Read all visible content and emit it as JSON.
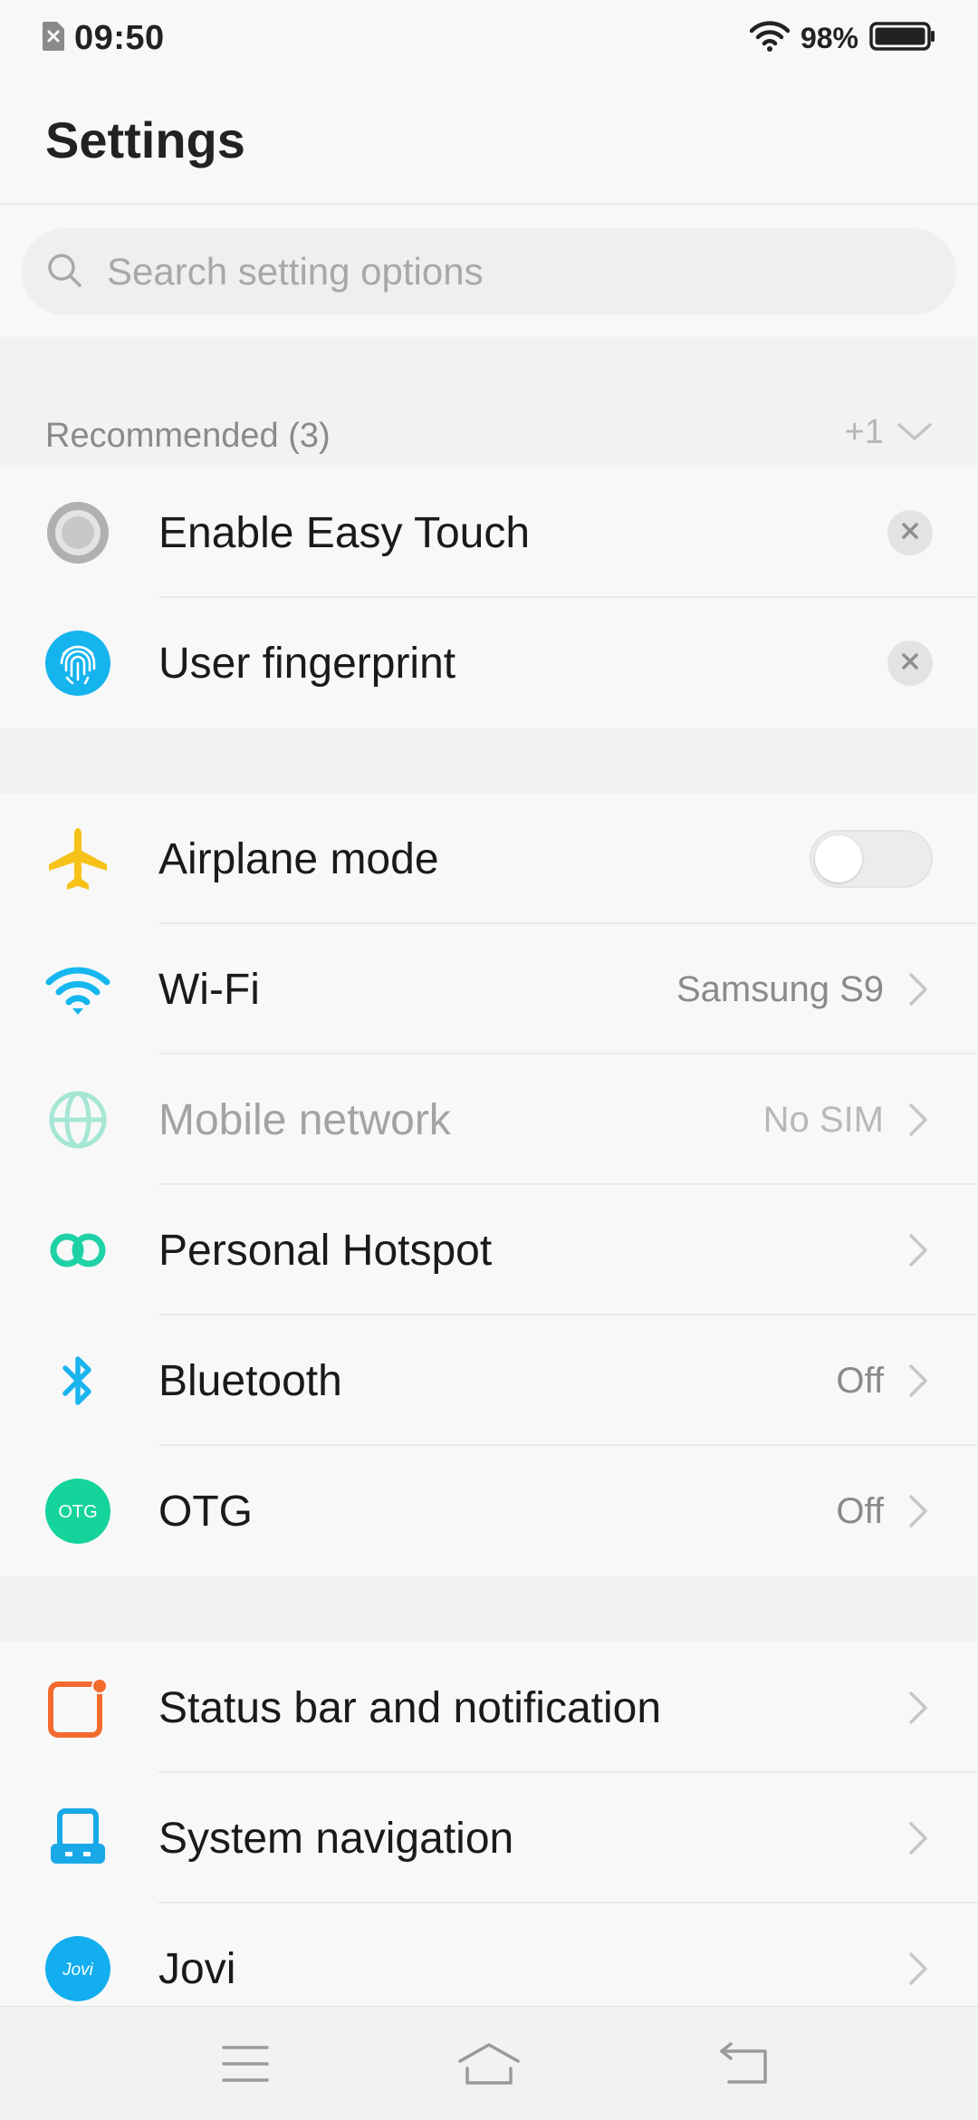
{
  "status_bar": {
    "time": "09:50",
    "battery_percent": "98%",
    "icons": [
      "no-sim-icon",
      "wifi-icon",
      "battery-icon"
    ]
  },
  "header": {
    "title": "Settings"
  },
  "search": {
    "placeholder": "Search setting options"
  },
  "recommended": {
    "title": "Recommended (3)",
    "more_count": "+1",
    "items": [
      {
        "label": "Enable Easy Touch",
        "icon": "easy-touch-icon"
      },
      {
        "label": "User fingerprint",
        "icon": "fingerprint-icon"
      }
    ]
  },
  "connectivity": {
    "items": [
      {
        "label": "Airplane mode",
        "icon": "airplane-icon",
        "control": "toggle",
        "toggle_on": false
      },
      {
        "label": "Wi-Fi",
        "icon": "wifi-icon",
        "value": "Samsung S9"
      },
      {
        "label": "Mobile network",
        "icon": "globe-icon",
        "value": "No SIM",
        "disabled": true
      },
      {
        "label": "Personal Hotspot",
        "icon": "hotspot-icon",
        "value": ""
      },
      {
        "label": "Bluetooth",
        "icon": "bluetooth-icon",
        "value": "Off"
      },
      {
        "label": "OTG",
        "icon": "otg-icon",
        "icon_text": "OTG",
        "value": "Off"
      }
    ]
  },
  "system": {
    "items": [
      {
        "label": "Status bar and notification",
        "icon": "status-bar-icon"
      },
      {
        "label": "System navigation",
        "icon": "system-navigation-icon"
      },
      {
        "label": "Jovi",
        "icon": "jovi-icon",
        "icon_text": "Jovi"
      }
    ]
  },
  "nav_bar": {
    "buttons": [
      "menu-icon",
      "home-icon",
      "back-icon"
    ]
  },
  "colors": {
    "airplane": "#f6c219",
    "wifi": "#15b7ee",
    "globe_disabled": "#a5e6d4",
    "hotspot": "#1fd1a6",
    "bluetooth": "#1ab4ee",
    "otg": "#14d49b",
    "status_bar_icon": "#f36a2e",
    "system_nav_icon": "#19a9e8",
    "jovi": "#12aef0"
  }
}
